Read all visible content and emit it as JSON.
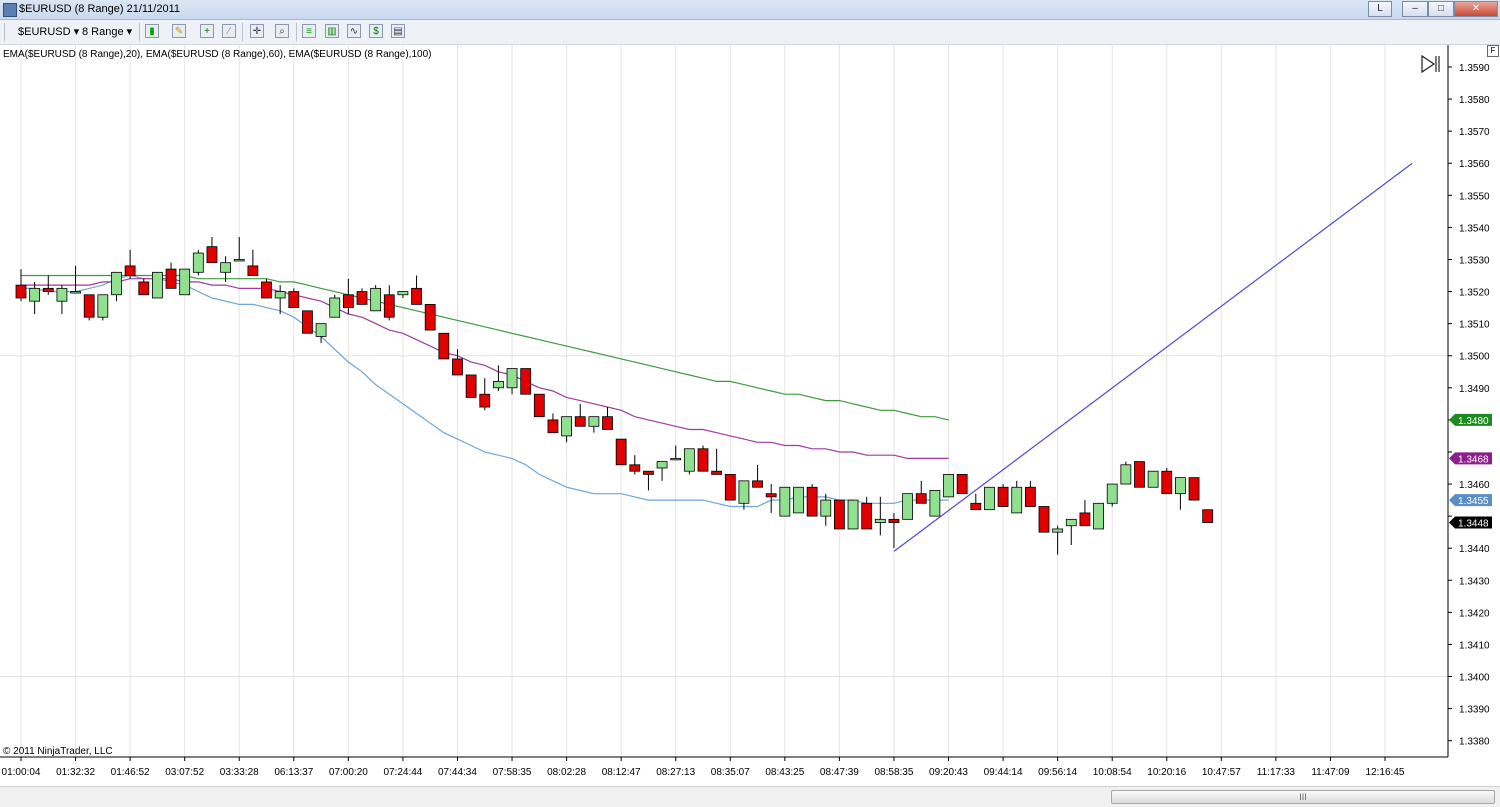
{
  "window": {
    "title": "$EURUSD (8 Range)  21/11/2011",
    "buttons": [
      "L",
      "–",
      "□",
      "✕"
    ]
  },
  "toolbar": {
    "instrument": "$EURUSD",
    "interval": "8 Range",
    "icons": [
      "candles-icon",
      "pencil-icon",
      "add-indicator-icon",
      "strategy-icon",
      "crosshair-icon",
      "zoom-icon",
      "bars-icon",
      "strategies-icon",
      "chart-trader-icon",
      "dollar-icon",
      "properties-icon"
    ]
  },
  "chart": {
    "indicators_label": "EMA($EURUSD (8 Range),20), EMA($EURUSD (8 Range),60), EMA($EURUSD (8 Range),100)",
    "copyright": "© 2011 NinjaTrader, LLC",
    "right_badge": "F"
  },
  "chart_data": {
    "type": "candlestick",
    "ylim": [
      1.3375,
      1.36
    ],
    "y_ticks": [
      1.338,
      1.339,
      1.34,
      1.341,
      1.342,
      1.343,
      1.344,
      1.345,
      1.346,
      1.347,
      1.348,
      1.349,
      1.35,
      1.351,
      1.352,
      1.353,
      1.354,
      1.355,
      1.356,
      1.357,
      1.358,
      1.359
    ],
    "y_tick_labels": [
      "1.3380",
      "1.3390",
      "1.3400",
      "1.3410",
      "1.3420",
      "1.3430",
      "1.3440",
      "",
      "1.3460",
      "",
      "",
      "1.3490",
      "1.3500",
      "1.3510",
      "1.3520",
      "1.3530",
      "1.3540",
      "1.3550",
      "1.3560",
      "1.3570",
      "1.3580",
      "1.3590"
    ],
    "x_labels": [
      "01:00:04",
      "01:32:32",
      "01:46:52",
      "03:07:52",
      "03:33:28",
      "06:13:37",
      "07:00:20",
      "07:24:44",
      "07:44:34",
      "07:58:35",
      "08:02:28",
      "08:12:47",
      "08:27:13",
      "08:35:07",
      "08:43:25",
      "08:47:39",
      "08:58:35",
      "09:20:43",
      "09:44:14",
      "09:56:14",
      "10:08:54",
      "10:20:16",
      "10:47:57",
      "11:17:33",
      "11:47:09",
      "12:16:45"
    ],
    "x_label_index": [
      0,
      4,
      8,
      12,
      16,
      20,
      24,
      28,
      32,
      36,
      40,
      44,
      48,
      52,
      56,
      60,
      64,
      68,
      72,
      76,
      80,
      84,
      88,
      92,
      96,
      100
    ],
    "candles": [
      [
        1.3522,
        1.3527,
        1.3517,
        1.3518
      ],
      [
        1.3517,
        1.3523,
        1.3513,
        1.3521
      ],
      [
        1.3521,
        1.3525,
        1.3519,
        1.352
      ],
      [
        1.3517,
        1.3522,
        1.3513,
        1.3521
      ],
      [
        1.352,
        1.3528,
        1.352,
        1.352
      ],
      [
        1.3519,
        1.3519,
        1.3511,
        1.3512
      ],
      [
        1.3512,
        1.3519,
        1.3511,
        1.3519
      ],
      [
        1.3519,
        1.3526,
        1.3517,
        1.3526
      ],
      [
        1.3528,
        1.3533,
        1.3524,
        1.3525
      ],
      [
        1.3523,
        1.3524,
        1.3519,
        1.3519
      ],
      [
        1.3518,
        1.3526,
        1.3518,
        1.3526
      ],
      [
        1.3527,
        1.3529,
        1.3521,
        1.3521
      ],
      [
        1.3519,
        1.3527,
        1.3519,
        1.3527
      ],
      [
        1.3526,
        1.3533,
        1.3525,
        1.3532
      ],
      [
        1.3534,
        1.3537,
        1.3529,
        1.3529
      ],
      [
        1.3526,
        1.3531,
        1.3523,
        1.3529
      ],
      [
        1.353,
        1.3537,
        1.353,
        1.353
      ],
      [
        1.3528,
        1.3533,
        1.3525,
        1.3525
      ],
      [
        1.3523,
        1.3524,
        1.3518,
        1.3518
      ],
      [
        1.3518,
        1.3522,
        1.3513,
        1.352
      ],
      [
        1.352,
        1.3521,
        1.3515,
        1.3515
      ],
      [
        1.3514,
        1.3514,
        1.3507,
        1.3507
      ],
      [
        1.3506,
        1.351,
        1.3504,
        1.351
      ],
      [
        1.3512,
        1.3519,
        1.3512,
        1.3518
      ],
      [
        1.3519,
        1.3524,
        1.3513,
        1.3515
      ],
      [
        1.352,
        1.3521,
        1.3516,
        1.3516
      ],
      [
        1.3514,
        1.3522,
        1.3514,
        1.3521
      ],
      [
        1.3519,
        1.3522,
        1.3511,
        1.3512
      ],
      [
        1.3519,
        1.352,
        1.3518,
        1.352
      ],
      [
        1.3521,
        1.3525,
        1.3516,
        1.3516
      ],
      [
        1.3516,
        1.3516,
        1.3508,
        1.3508
      ],
      [
        1.3507,
        1.3507,
        1.3499,
        1.3499
      ],
      [
        1.3499,
        1.3502,
        1.3494,
        1.3494
      ],
      [
        1.3494,
        1.3494,
        1.3487,
        1.3487
      ],
      [
        1.3488,
        1.3493,
        1.3483,
        1.3484
      ],
      [
        1.349,
        1.3497,
        1.3489,
        1.3492
      ],
      [
        1.349,
        1.3496,
        1.3488,
        1.3496
      ],
      [
        1.3496,
        1.3496,
        1.3488,
        1.3488
      ],
      [
        1.3488,
        1.3488,
        1.3481,
        1.3481
      ],
      [
        1.348,
        1.3482,
        1.3476,
        1.3476
      ],
      [
        1.3475,
        1.3481,
        1.3473,
        1.3481
      ],
      [
        1.3481,
        1.3485,
        1.3478,
        1.3478
      ],
      [
        1.3478,
        1.3481,
        1.3476,
        1.3481
      ],
      [
        1.3481,
        1.3484,
        1.3477,
        1.3477
      ],
      [
        1.3474,
        1.3474,
        1.3466,
        1.3466
      ],
      [
        1.3466,
        1.3469,
        1.3463,
        1.3464
      ],
      [
        1.3464,
        1.3464,
        1.3458,
        1.3463
      ],
      [
        1.3465,
        1.3467,
        1.3461,
        1.3467
      ],
      [
        1.3468,
        1.3472,
        1.3468,
        1.3468
      ],
      [
        1.3464,
        1.3471,
        1.3463,
        1.3471
      ],
      [
        1.3471,
        1.3472,
        1.3464,
        1.3464
      ],
      [
        1.3464,
        1.3471,
        1.3464,
        1.3463
      ],
      [
        1.3463,
        1.3463,
        1.3455,
        1.3455
      ],
      [
        1.3454,
        1.3461,
        1.3452,
        1.3461
      ],
      [
        1.3461,
        1.3466,
        1.3459,
        1.3459
      ],
      [
        1.3457,
        1.346,
        1.3451,
        1.3456
      ],
      [
        1.345,
        1.3459,
        1.345,
        1.3459
      ],
      [
        1.3451,
        1.3459,
        1.3451,
        1.3459
      ],
      [
        1.3459,
        1.346,
        1.345,
        1.345
      ],
      [
        1.345,
        1.3457,
        1.3447,
        1.3455
      ],
      [
        1.3455,
        1.3455,
        1.3446,
        1.3446
      ],
      [
        1.3446,
        1.3455,
        1.3446,
        1.3455
      ],
      [
        1.3454,
        1.3456,
        1.3446,
        1.3446
      ],
      [
        1.3448,
        1.3456,
        1.3444,
        1.3449
      ],
      [
        1.3449,
        1.3451,
        1.344,
        1.3448
      ],
      [
        1.3449,
        1.3457,
        1.3449,
        1.3457
      ],
      [
        1.3457,
        1.3461,
        1.3454,
        1.3454
      ],
      [
        1.345,
        1.3458,
        1.345,
        1.3458
      ],
      [
        1.3456,
        1.3463,
        1.3456,
        1.3463
      ],
      [
        1.3463,
        1.3463,
        1.3457,
        1.3457
      ],
      [
        1.3454,
        1.3457,
        1.3452,
        1.3452
      ],
      [
        1.3452,
        1.3459,
        1.3452,
        1.3459
      ],
      [
        1.3459,
        1.346,
        1.3453,
        1.3453
      ],
      [
        1.3451,
        1.3461,
        1.3451,
        1.3459
      ],
      [
        1.3459,
        1.3461,
        1.3453,
        1.3453
      ],
      [
        1.3453,
        1.3453,
        1.3445,
        1.3445
      ],
      [
        1.3445,
        1.3447,
        1.3438,
        1.3446
      ],
      [
        1.3447,
        1.3449,
        1.3441,
        1.3449
      ],
      [
        1.3451,
        1.3455,
        1.3447,
        1.3447
      ],
      [
        1.3446,
        1.3454,
        1.3446,
        1.3454
      ],
      [
        1.3454,
        1.346,
        1.3453,
        1.346
      ],
      [
        1.346,
        1.3467,
        1.346,
        1.3466
      ],
      [
        1.3467,
        1.3467,
        1.3459,
        1.3459
      ],
      [
        1.3459,
        1.3464,
        1.3459,
        1.3464
      ],
      [
        1.3464,
        1.3465,
        1.3457,
        1.3457
      ],
      [
        1.3457,
        1.3462,
        1.3452,
        1.3462
      ],
      [
        1.3462,
        1.3462,
        1.3455,
        1.3455
      ],
      [
        1.3452,
        1.3452,
        1.3448,
        1.3448
      ]
    ],
    "series": [
      {
        "name": "EMA($EURUSD (8 Range),20)",
        "color": "#6fa6d6",
        "end_label": "1.3455",
        "values": [
          1.3521,
          1.3521,
          1.352,
          1.352,
          1.352,
          1.3521,
          1.3522,
          1.3524,
          1.3525,
          1.3524,
          1.3524,
          1.3523,
          1.3522,
          1.352,
          1.3518,
          1.3517,
          1.3516,
          1.3516,
          1.3515,
          1.3514,
          1.3512,
          1.3509,
          1.3506,
          1.3502,
          1.3498,
          1.3495,
          1.3491,
          1.3488,
          1.3485,
          1.3482,
          1.3479,
          1.3476,
          1.3474,
          1.3472,
          1.347,
          1.3469,
          1.3468,
          1.3466,
          1.3463,
          1.3461,
          1.3459,
          1.3458,
          1.3457,
          1.3457,
          1.3457,
          1.3456,
          1.3455,
          1.3455,
          1.3455,
          1.3455,
          1.3455,
          1.3454,
          1.3453,
          1.3453,
          1.3453,
          1.3455,
          1.3455,
          1.3456,
          1.3456,
          1.3456,
          1.3455,
          1.3455,
          1.3454,
          1.3454,
          1.3454,
          1.3455,
          1.3455,
          1.3455,
          1.3455
        ]
      },
      {
        "name": "EMA($EURUSD (8 Range),60)",
        "color": "#a03aa0",
        "end_label": "1.3468",
        "values": [
          1.3522,
          1.3522,
          1.3522,
          1.3522,
          1.3522,
          1.3522,
          1.3523,
          1.3523,
          1.3524,
          1.3524,
          1.3524,
          1.3524,
          1.3523,
          1.3523,
          1.3522,
          1.3522,
          1.3521,
          1.3521,
          1.3521,
          1.352,
          1.3519,
          1.3518,
          1.3517,
          1.3515,
          1.3513,
          1.3512,
          1.351,
          1.3508,
          1.3507,
          1.3505,
          1.3503,
          1.3501,
          1.35,
          1.3498,
          1.3497,
          1.3495,
          1.3494,
          1.3492,
          1.349,
          1.3489,
          1.3487,
          1.3486,
          1.3485,
          1.3484,
          1.3483,
          1.3481,
          1.348,
          1.3479,
          1.3478,
          1.3477,
          1.3477,
          1.3476,
          1.3475,
          1.3474,
          1.3473,
          1.3473,
          1.3472,
          1.3472,
          1.3471,
          1.3471,
          1.347,
          1.347,
          1.3469,
          1.3469,
          1.3469,
          1.3468,
          1.3468,
          1.3468,
          1.3468
        ]
      },
      {
        "name": "EMA($EURUSD (8 Range),100)",
        "color": "#3e9a3e",
        "end_label": "1.3480",
        "values": [
          1.3525,
          1.3525,
          1.3525,
          1.3525,
          1.3525,
          1.3525,
          1.3525,
          1.3525,
          1.3525,
          1.3525,
          1.3525,
          1.3525,
          1.3525,
          1.3524,
          1.3524,
          1.3524,
          1.3524,
          1.3524,
          1.3524,
          1.3523,
          1.3523,
          1.3522,
          1.3521,
          1.352,
          1.3519,
          1.3518,
          1.3517,
          1.3516,
          1.3515,
          1.3514,
          1.3513,
          1.3512,
          1.3511,
          1.351,
          1.3509,
          1.3508,
          1.3507,
          1.3506,
          1.3505,
          1.3504,
          1.3503,
          1.3502,
          1.3501,
          1.35,
          1.3499,
          1.3498,
          1.3497,
          1.3496,
          1.3495,
          1.3494,
          1.3493,
          1.3492,
          1.3492,
          1.3491,
          1.349,
          1.3489,
          1.3488,
          1.3488,
          1.3487,
          1.3486,
          1.3486,
          1.3485,
          1.3484,
          1.3483,
          1.3483,
          1.3482,
          1.3481,
          1.3481,
          1.348
        ]
      }
    ],
    "last_price_label": "1.3448",
    "last_price_color": "#000000",
    "trendline": {
      "color": "#4a4adc",
      "from": [
        64,
        1.3439
      ],
      "to": [
        102,
        1.356
      ]
    },
    "up_color": "#90e090",
    "down_color": "#e00000",
    "grid": true,
    "axis_side": "right"
  },
  "scrollbar": {
    "grip": "III"
  }
}
